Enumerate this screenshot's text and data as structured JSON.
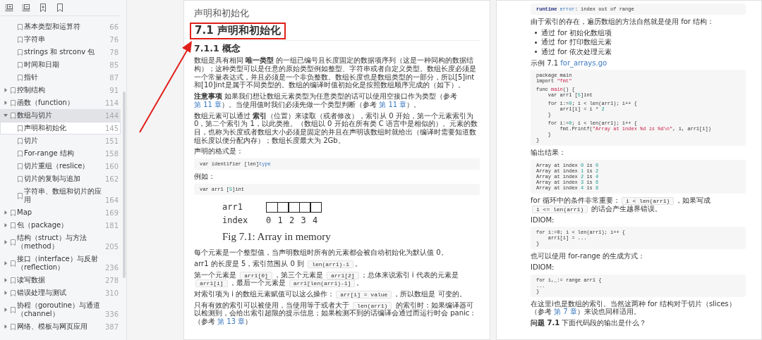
{
  "pointer_arrow": true,
  "sidebar": {
    "continued_items": [
      {
        "title": "基本类型和运算符",
        "page": "66",
        "selected": false,
        "current": false
      },
      {
        "title": "字符串",
        "page": "76",
        "selected": false,
        "current": false
      },
      {
        "title": "strings 和 strconv 包",
        "page": "78",
        "selected": false,
        "current": false
      },
      {
        "title": "时间和日期",
        "page": "85",
        "selected": false,
        "current": false
      },
      {
        "title": "指针",
        "page": "87",
        "selected": false,
        "current": false
      }
    ],
    "items": [
      {
        "title": "控制结构",
        "page": "91",
        "expanded": false,
        "selected": false,
        "current": false
      },
      {
        "title": "函数（function）",
        "page": "114",
        "expanded": false,
        "selected": false,
        "current": false
      },
      {
        "title": "数组与切片",
        "page": "144",
        "expanded": true,
        "selected": true,
        "current": false,
        "children": [
          {
            "title": "声明和初始化",
            "page": "145",
            "selected": false,
            "current": true
          },
          {
            "title": "切片",
            "page": "151",
            "selected": false,
            "current": false
          },
          {
            "title": "For-range 结构",
            "page": "158",
            "selected": false,
            "current": false
          },
          {
            "title": "切片重组（reslice）",
            "page": "160",
            "selected": false,
            "current": false
          },
          {
            "title": "切片的复制与追加",
            "page": "162",
            "selected": false,
            "current": false
          },
          {
            "title": "字符串、数组和切片的应用",
            "page": "164",
            "selected": false,
            "current": false
          }
        ]
      },
      {
        "title": "Map",
        "page": "169",
        "expanded": false,
        "selected": false,
        "current": false
      },
      {
        "title": "包（package）",
        "page": "181",
        "expanded": false,
        "selected": false,
        "current": false
      },
      {
        "title": "结构（struct）与方法（method）",
        "page": "205",
        "expanded": false,
        "selected": false,
        "current": false
      },
      {
        "title": "接口（interface）与反射（reflection）",
        "page": "236",
        "expanded": false,
        "selected": false,
        "current": false
      },
      {
        "title": "读写数据",
        "page": "278",
        "expanded": false,
        "selected": false,
        "current": false
      },
      {
        "title": "错误处理与测试",
        "page": "310",
        "expanded": false,
        "selected": false,
        "current": false
      },
      {
        "title": "协程（goroutine）与通道（channel）",
        "page": "336",
        "expanded": false,
        "selected": false,
        "current": false
      },
      {
        "title": "网络、模板与网页应用",
        "page": "387",
        "expanded": false,
        "selected": false,
        "current": false
      }
    ]
  },
  "pages": [
    {
      "blocks": [
        {
          "kind": "running_header",
          "text": "声明和初始化"
        },
        {
          "kind": "heading",
          "text": "7.1 声明和初始化",
          "boxed": true
        },
        {
          "kind": "subheading",
          "text": "7.1.1 概念"
        },
        {
          "kind": "paragraph",
          "segments": [
            {
              "kind": "text",
              "text": "数组是具有相同 "
            },
            {
              "kind": "bold",
              "text": "唯一类型"
            },
            {
              "kind": "text",
              "text": " 的一组已编号且长度固定的数据项序列（这是一种同构的数据结构）；这种类型可以是任意的原始类型例如整型、字符串或者自定义类型。数组长度必须是一个常量表达式，并且必须是一个非负整数。数组长度也是数组类型的一部分，所以[5]int和[10]int是属于不同类型的。数组的编译时值初始化是按照数组顺序完成的（如下）。"
            }
          ]
        },
        {
          "kind": "paragraph",
          "segments": [
            {
              "kind": "bold",
              "text": "注意事项"
            },
            {
              "kind": "text",
              "text": " 如果我们想让数组元素类型为任意类型的话可以使用空接口作为类型（参考 "
            },
            {
              "kind": "link",
              "text": "第 11 章"
            },
            {
              "kind": "text",
              "text": "）。当使用值时我们必须先做一个类型判断（参考 "
            },
            {
              "kind": "link",
              "text": "第 11 章"
            },
            {
              "kind": "text",
              "text": "）。"
            }
          ]
        },
        {
          "kind": "paragraph",
          "segments": [
            {
              "kind": "text",
              "text": "数组元素可以通过 "
            },
            {
              "kind": "bold",
              "text": "索引"
            },
            {
              "kind": "text",
              "text": "（位置）来读取（或者修改），索引从 0 开始，第一个元素索引为 0，第二个索引为 1，以此类推。（数组以 0 开始在所有类 C 语言中是相似的）。元素的数目，也称为长度或者数组大小必须是固定的并且在声明该数组时就给出（编译时需要知道数组长度以便分配内存）；数组长度最大为 2Gb。"
            }
          ]
        },
        {
          "kind": "paragraph",
          "segments": [
            {
              "kind": "text",
              "text": "声明的格式是："
            }
          ]
        },
        {
          "kind": "code",
          "groups": [
            [
              [
                {
                  "kind": "plain",
                  "text": "var identifier [len]"
                },
                {
                  "kind": "type",
                  "text": "type"
                }
              ]
            ]
          ]
        },
        {
          "kind": "paragraph",
          "segments": [
            {
              "kind": "text",
              "text": "例如："
            }
          ]
        },
        {
          "kind": "code",
          "groups": [
            [
              [
                {
                  "kind": "plain",
                  "text": "var arr1 ["
                },
                {
                  "kind": "num",
                  "text": "5"
                },
                {
                  "kind": "plain",
                  "text": "]int"
                }
              ]
            ]
          ]
        },
        {
          "kind": "figure",
          "array_label": "arr1",
          "index_label": "index",
          "indices": [
            "0",
            "1",
            "2",
            "3",
            "4"
          ],
          "caption": "Fig 7.1: Array in memory"
        },
        {
          "kind": "paragraph",
          "segments": [
            {
              "kind": "text",
              "text": "每个元素是一个整型值，当声明数组时所有的元素都会被自动初始化为默认值 0。"
            }
          ]
        },
        {
          "kind": "paragraph",
          "segments": [
            {
              "kind": "text",
              "text": "arr1 的长度是 5，索引范围从 0 到 "
            },
            {
              "kind": "code",
              "text": "len(arr1)-1"
            },
            {
              "kind": "text",
              "text": "。"
            }
          ]
        },
        {
          "kind": "paragraph",
          "segments": [
            {
              "kind": "text",
              "text": "第一个元素是 "
            },
            {
              "kind": "code",
              "text": "arr1[0]"
            },
            {
              "kind": "text",
              "text": "，第三个元素是 "
            },
            {
              "kind": "code",
              "text": "arr1[2]"
            },
            {
              "kind": "text",
              "text": "；总体来说索引 i 代表的元素是 "
            },
            {
              "kind": "code",
              "text": "arr1[i]"
            },
            {
              "kind": "text",
              "text": "，最后一个元素是 "
            },
            {
              "kind": "code",
              "text": "arr1[len(arr1)-1]"
            },
            {
              "kind": "text",
              "text": "。"
            }
          ]
        },
        {
          "kind": "paragraph",
          "segments": [
            {
              "kind": "text",
              "text": "对索引项为 i 的数组元素赋值可以这么操作："
            },
            {
              "kind": "code",
              "text": "arr[i] = value"
            },
            {
              "kind": "text",
              "text": "，所以数组是 可变的。"
            }
          ]
        },
        {
          "kind": "paragraph",
          "segments": [
            {
              "kind": "text",
              "text": "只有有效的索引可以被使用，当使用等于或者大于 "
            },
            {
              "kind": "code",
              "text": "len(arr1)"
            },
            {
              "kind": "text",
              "text": " 的索引时：如果编译器可以检测到，会给出索引超限的提示信息；如果检测不到的话编译会通过而运行时会 panic：（参考 "
            },
            {
              "kind": "link",
              "text": "第 13 章"
            },
            {
              "kind": "text",
              "text": "）"
            }
          ]
        }
      ]
    },
    {
      "blocks": [
        {
          "kind": "code",
          "groups": [
            [
              [
                {
                  "kind": "kw",
                  "text": "runtime"
                },
                {
                  "kind": "type",
                  "text": " error"
                },
                {
                  "kind": "plain",
                  "text": ": index out of range"
                }
              ]
            ]
          ]
        },
        {
          "kind": "paragraph",
          "segments": [
            {
              "kind": "text",
              "text": "由于索引的存在，遍历数组的方法自然就是使用 for 结构："
            }
          ]
        },
        {
          "kind": "bullets",
          "items": [
            "通过 for 初始化数组项",
            "通过 for 打印数组元素",
            "通过 for 依次处理元素"
          ]
        },
        {
          "kind": "paragraph",
          "segments": [
            {
              "kind": "text",
              "text": "示例 7.1 "
            },
            {
              "kind": "link",
              "text": "for_arrays.go"
            }
          ]
        },
        {
          "kind": "code",
          "groups": [
            [
              [
                {
                  "kind": "plain",
                  "text": "package main"
                }
              ],
              [
                {
                  "kind": "plain",
                  "text": "import "
                },
                {
                  "kind": "str",
                  "text": "\"fmt\""
                }
              ]
            ],
            [
              [
                {
                  "kind": "plain",
                  "text": "func "
                },
                {
                  "kind": "str",
                  "text": "main"
                },
                {
                  "kind": "plain",
                  "text": "() {"
                }
              ],
              [
                {
                  "kind": "plain",
                  "text": "    var arr1 ["
                },
                {
                  "kind": "num",
                  "text": "5"
                },
                {
                  "kind": "plain",
                  "text": "]int"
                }
              ]
            ],
            [
              [
                {
                  "kind": "plain",
                  "text": "    for i:="
                },
                {
                  "kind": "num",
                  "text": "0"
                },
                {
                  "kind": "plain",
                  "text": "; i < len(arr1); i++ {"
                }
              ],
              [
                {
                  "kind": "plain",
                  "text": "        arr1[i] = i * "
                },
                {
                  "kind": "num",
                  "text": "2"
                }
              ],
              [
                {
                  "kind": "plain",
                  "text": "    }"
                }
              ]
            ],
            [
              [
                {
                  "kind": "plain",
                  "text": "    for i:="
                },
                {
                  "kind": "num",
                  "text": "0"
                },
                {
                  "kind": "plain",
                  "text": "; i < len(arr1); i++ {"
                }
              ],
              [
                {
                  "kind": "plain",
                  "text": "        fmt.Printf("
                },
                {
                  "kind": "str",
                  "text": "\"Array at index %d is %d\\n\""
                },
                {
                  "kind": "plain",
                  "text": ", i, arr1[i])"
                }
              ],
              [
                {
                  "kind": "plain",
                  "text": "    }"
                }
              ],
              [
                {
                  "kind": "plain",
                  "text": "}"
                }
              ]
            ]
          ]
        },
        {
          "kind": "paragraph",
          "segments": [
            {
              "kind": "text",
              "text": "输出结果："
            }
          ]
        },
        {
          "kind": "code",
          "groups": [
            [
              [
                {
                  "kind": "plain",
                  "text": "Array at index "
                },
                {
                  "kind": "num",
                  "text": "0"
                },
                {
                  "kind": "plain",
                  "text": " is "
                },
                {
                  "kind": "num",
                  "text": "0"
                }
              ],
              [
                {
                  "kind": "plain",
                  "text": "Array at index "
                },
                {
                  "kind": "num",
                  "text": "1"
                },
                {
                  "kind": "plain",
                  "text": " is "
                },
                {
                  "kind": "num",
                  "text": "2"
                }
              ],
              [
                {
                  "kind": "plain",
                  "text": "Array at index "
                },
                {
                  "kind": "num",
                  "text": "2"
                },
                {
                  "kind": "plain",
                  "text": " is "
                },
                {
                  "kind": "num",
                  "text": "4"
                }
              ],
              [
                {
                  "kind": "plain",
                  "text": "Array at index "
                },
                {
                  "kind": "num",
                  "text": "3"
                },
                {
                  "kind": "plain",
                  "text": " is "
                },
                {
                  "kind": "num",
                  "text": "6"
                }
              ],
              [
                {
                  "kind": "plain",
                  "text": "Array at index "
                },
                {
                  "kind": "num",
                  "text": "4"
                },
                {
                  "kind": "plain",
                  "text": " is "
                },
                {
                  "kind": "num",
                  "text": "8"
                }
              ]
            ]
          ]
        },
        {
          "kind": "paragraph",
          "segments": [
            {
              "kind": "text",
              "text": "for 循环中的条件非常重要："
            },
            {
              "kind": "code",
              "text": "i < len(arr1)"
            },
            {
              "kind": "text",
              "text": "，如果写成 "
            },
            {
              "kind": "code",
              "text": "i <= len(arr1)"
            },
            {
              "kind": "text",
              "text": " 的话会产生越界错误。"
            }
          ]
        },
        {
          "kind": "paragraph",
          "segments": [
            {
              "kind": "text",
              "text": "IDIOM:"
            }
          ]
        },
        {
          "kind": "code",
          "groups": [
            [
              [
                {
                  "kind": "plain",
                  "text": "for i:=0; i < len(arr1); i++ {"
                }
              ],
              [
                {
                  "kind": "plain",
                  "text": "    arr1[i] = ..."
                }
              ],
              [
                {
                  "kind": "plain",
                  "text": "}"
                }
              ]
            ]
          ]
        },
        {
          "kind": "paragraph",
          "segments": [
            {
              "kind": "text",
              "text": "也可以使用 for-range 的生成方式："
            }
          ]
        },
        {
          "kind": "paragraph",
          "segments": [
            {
              "kind": "text",
              "text": "IDIOM:"
            }
          ]
        },
        {
          "kind": "code",
          "groups": [
            [
              [
                {
                  "kind": "plain",
                  "text": "for i,_:= range arr1 {"
                }
              ],
              [
                {
                  "kind": "plain",
                  "text": "..."
                }
              ],
              [
                {
                  "kind": "plain",
                  "text": "}"
                }
              ]
            ]
          ]
        },
        {
          "kind": "paragraph",
          "segments": [
            {
              "kind": "text",
              "text": "在这里i也是数组的索引。当然这两种 for 结构对于切片（slices）（参考 "
            },
            {
              "kind": "link",
              "text": "第 7 章"
            },
            {
              "kind": "text",
              "text": "）来说也同样适用。"
            }
          ]
        },
        {
          "kind": "paragraph",
          "segments": [
            {
              "kind": "bold",
              "text": "问题 7.1"
            },
            {
              "kind": "text",
              "text": " 下面代码段的输出是什么？"
            }
          ]
        }
      ]
    }
  ]
}
